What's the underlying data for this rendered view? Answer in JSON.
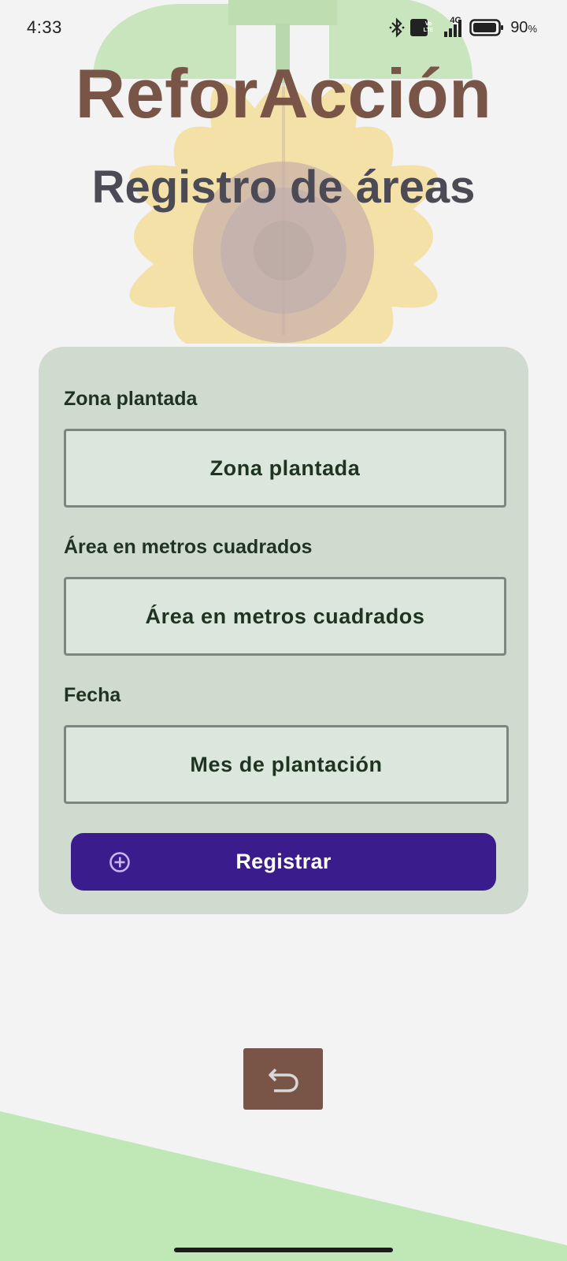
{
  "status_bar": {
    "time": "4:33",
    "network_type": "4G",
    "volte_badge": "Vo LTE",
    "battery_percent": "90",
    "battery_unit": "%",
    "icons": [
      "bluetooth-icon",
      "volte-icon",
      "signal-icon",
      "battery-icon"
    ]
  },
  "header": {
    "app_name": "ReforAcción",
    "page_title": "Registro de áreas"
  },
  "form": {
    "fields": [
      {
        "label": "Zona plantada",
        "placeholder": "Zona plantada",
        "value": ""
      },
      {
        "label": "Área en metros cuadrados",
        "placeholder": "Área en metros cuadrados",
        "value": ""
      },
      {
        "label": "Fecha",
        "placeholder": "Mes de plantación",
        "value": ""
      }
    ],
    "submit_label": "Registrar",
    "submit_icon": "add-circle-icon"
  },
  "navigation": {
    "back_icon": "undo-arrow-icon"
  },
  "colors": {
    "title_brown": "#795548",
    "heading_gray": "#4b4a55",
    "card_green": "#d0dbd0",
    "button_purple": "#3b1c8d",
    "leaf_green": "#a9dd9b",
    "petal_yellow": "#f3da88"
  }
}
